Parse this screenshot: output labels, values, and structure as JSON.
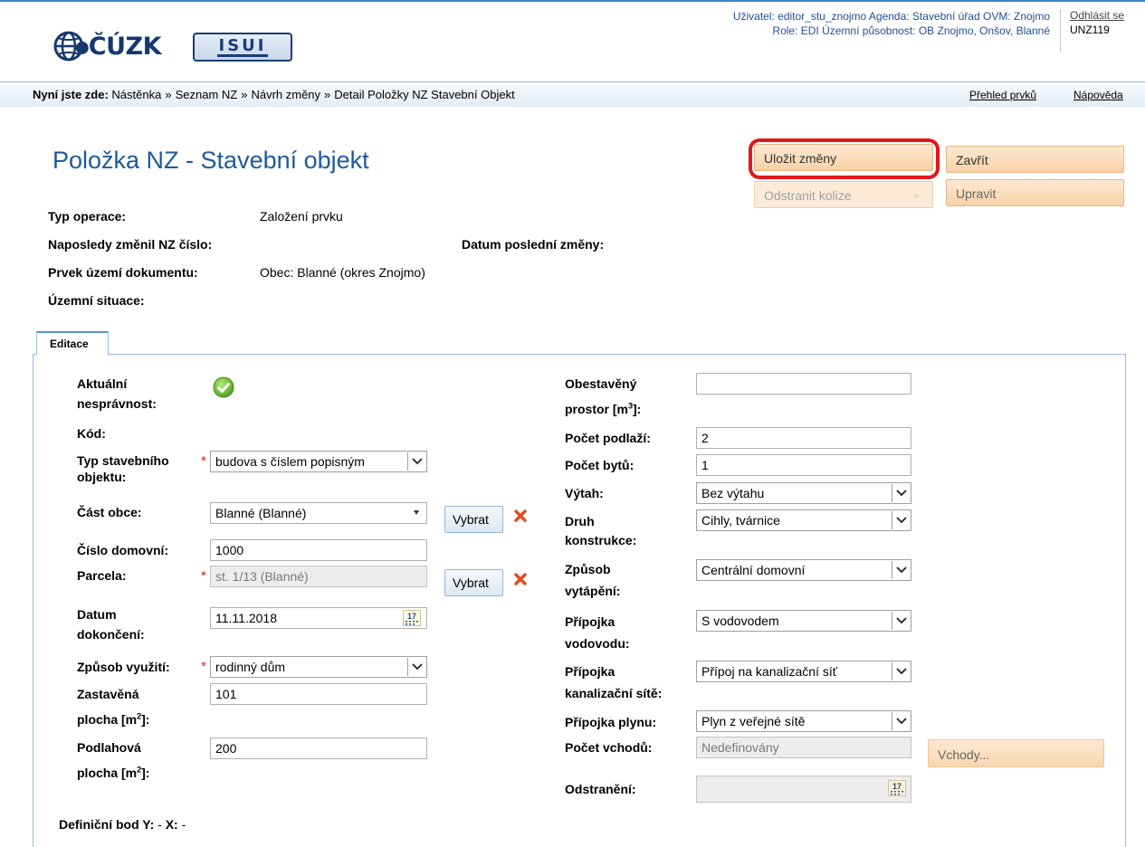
{
  "header": {
    "logo_text": "ČÚZK",
    "isui_logo": "ISUI",
    "user_line": "Uživatel: editor_stu_znojmo  Agenda: Stavební úřad  OVM: Znojmo",
    "role_line": "Role: EDI  Územní působnost: OB Znojmo, Onšov, Blanné",
    "logout": "Odhlásit se",
    "server_code": "UNZ119"
  },
  "breadcrumb": {
    "label": "Nyní jste zde:",
    "items": [
      "Nástěnka",
      "Seznam NZ",
      "Návrh změny",
      "Detail Položky NZ Stavební Objekt"
    ],
    "separator": "»",
    "overview_link": "Přehled prvků",
    "help_link": "Nápověda"
  },
  "page_title": "Položka NZ - Stavební objekt",
  "actions": {
    "save": "Uložit změny",
    "close": "Zavřít",
    "remove_conflicts": "Odstranit kolize",
    "edit": "Upravit",
    "arrow": "»"
  },
  "info": {
    "operation_type_label": "Typ operace:",
    "operation_type_value": "Založení prvku",
    "last_changed_label": "Naposledy změnil NZ číslo:",
    "last_change_date_label": "Datum poslední změny:",
    "territory_label": "Prvek území dokumentu:",
    "territory_value": "Obec: Blanné (okres Znojmo)",
    "situation_label": "Územní situace:"
  },
  "tab": {
    "label": "Editace"
  },
  "form_left": {
    "incorrect_label_1": "Aktuální",
    "incorrect_label_2": "nesprávnost:",
    "code_label": "Kód:",
    "building_type_label_1": "Typ stavebního",
    "building_type_label_2": "objektu:",
    "building_type_value": "budova s číslem popisným",
    "part_label": "Část obce:",
    "part_value": "Blanné (Blanné)",
    "select_button": "Vybrat",
    "house_number_label": "Číslo domovní:",
    "house_number_value": "1000",
    "parcel_label": "Parcela:",
    "parcel_value": "st. 1/13 (Blanné)",
    "completion_label_1": "Datum",
    "completion_label_2": "dokončení:",
    "completion_value": "11.11.2018",
    "calendar_day": "17",
    "usage_label": "Způsob využití:",
    "usage_value": "rodinný dům",
    "built_area_label_1": "Zastavěná",
    "built_area_label_2": "plocha [m",
    "built_area_label_3": "]:",
    "built_area_value": "101",
    "floor_area_label_1": "Podlahová",
    "floor_area_label_2": "plocha [m",
    "floor_area_label_3": "]:",
    "floor_area_value": "200",
    "sup2": "2",
    "required_mark": "*"
  },
  "form_right": {
    "volume_label_1": "Obestavěný",
    "volume_label_2": "prostor [m",
    "volume_label_3": "]:",
    "sup3": "3",
    "volume_value": "",
    "basement_label": "Počet podlaží:",
    "basement_value": "2",
    "flats_label": "Počet bytů:",
    "flats_value": "1",
    "elevator_label": "Výtah:",
    "elevator_value": "Bez výtahu",
    "construction_label_1": "Druh",
    "construction_label_2": "konstrukce:",
    "construction_value": "Cihly, tvárnice",
    "heating_label_1": "Způsob",
    "heating_label_2": "vytápění:",
    "heating_value": "Centrální domovní",
    "water_label_1": "Přípojka",
    "water_label_2": "vodovodu:",
    "water_value": "S vodovodem",
    "sewer_label_1": "Přípojka",
    "sewer_label_2": "kanalizační sítě:",
    "sewer_value": "Přípoj na kanalizační síť",
    "gas_label": "Přípojka plynu:",
    "gas_value": "Plyn z veřejné sítě",
    "entrances_label": "Počet vchodů:",
    "entrances_value": "Nedefinovány",
    "entrances_button": "Vchody...",
    "removal_label": "Odstranění:",
    "removal_value": "",
    "calendar_day": "17"
  },
  "definition_point": {
    "label_y": "Definiční bod Y:",
    "value_y": "-",
    "label_x": "X:",
    "value_x": "-"
  },
  "colors": {
    "title_blue": "#1e5a9a",
    "header_blue": "#1f4f9a",
    "orange_button": "#f8d1a6",
    "highlight_red": "#e3181c",
    "required_red": "#e31c1c"
  }
}
